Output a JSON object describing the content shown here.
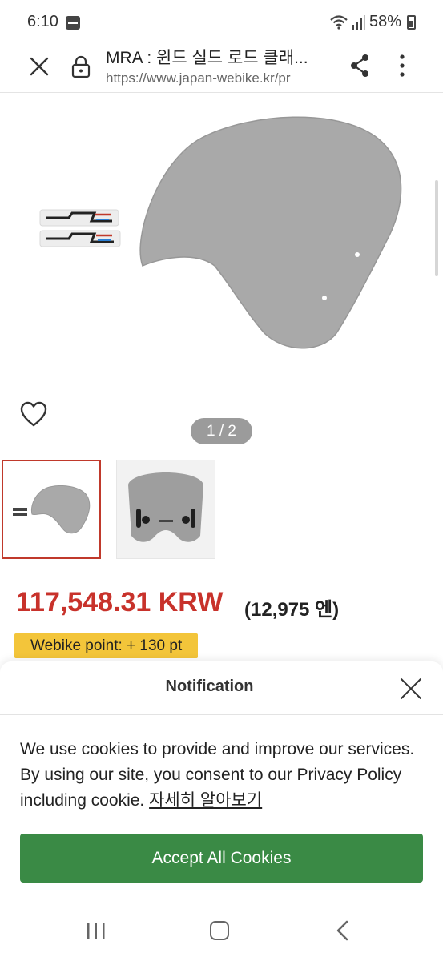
{
  "status_bar": {
    "time": "6:10",
    "battery": "58%"
  },
  "browser": {
    "title": "MRA : 윈드 실드 로드 클래...",
    "url": "https://www.japan-webike.kr/pr",
    "icons": [
      "close-icon",
      "lock-icon",
      "share-icon",
      "more-vert-icon"
    ]
  },
  "product": {
    "gallery_counter": "1 / 2",
    "price": "117,548.31 KRW",
    "price_secondary": "(12,975 엔)",
    "points": "Webike point: + 130 pt"
  },
  "cookie_sheet": {
    "title": "Notification",
    "message": "We use cookies to provide and improve our services. By using our site, you consent to our Privacy Policy including cookie.",
    "link": "자세히 알아보기",
    "accept_label": "Accept All Cookies"
  },
  "colors": {
    "price": "#c8322b",
    "points_badge": "#f3c53a",
    "accept_button": "#3a8a45",
    "selected_thumb_border": "#c0392b"
  }
}
